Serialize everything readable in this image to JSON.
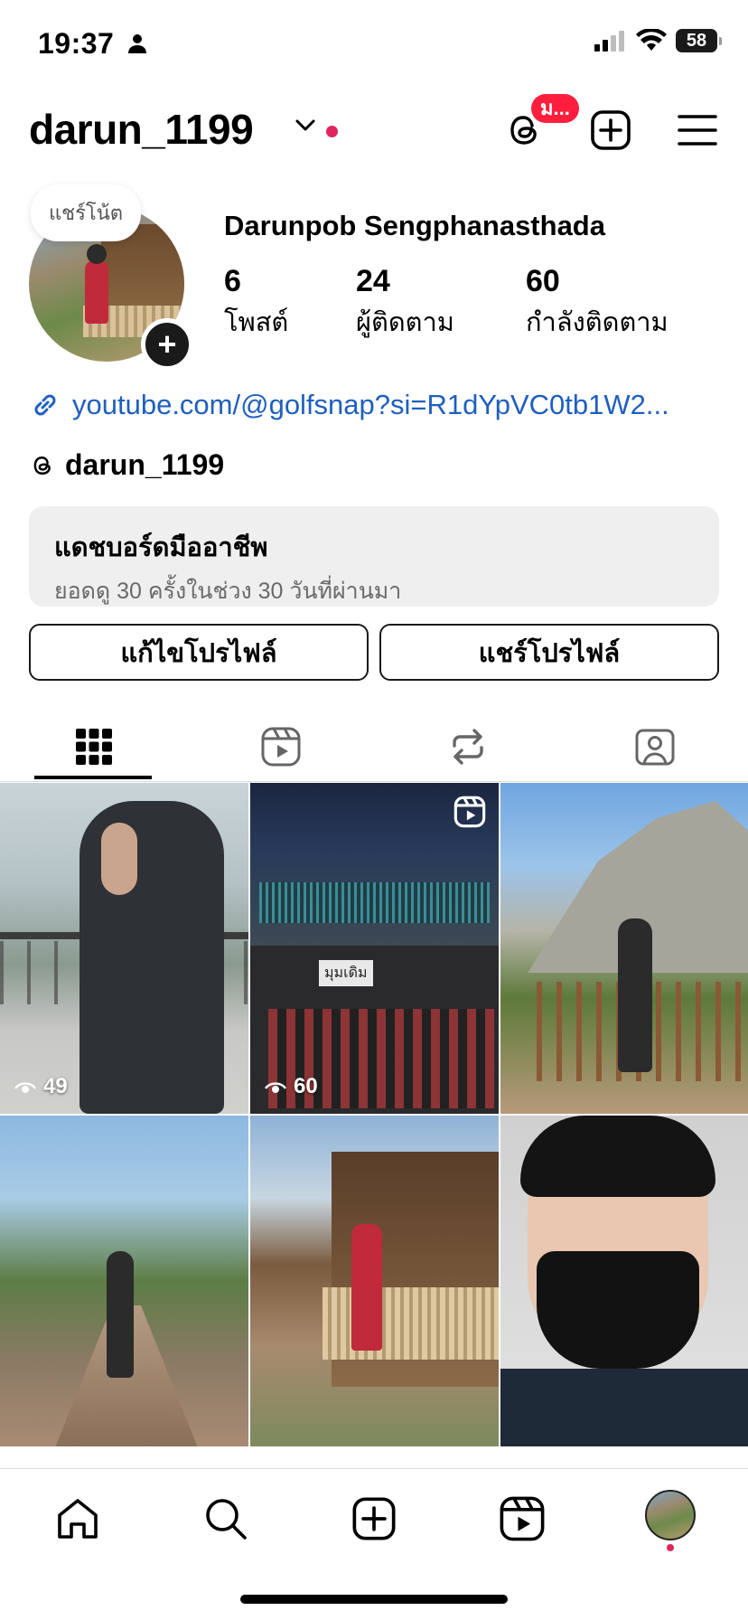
{
  "status_bar": {
    "time": "19:37",
    "battery": "58"
  },
  "header": {
    "username": "darun_1199",
    "threads_badge": "ม..."
  },
  "profile": {
    "note": "แชร์โน้ต",
    "full_name": "Darunpob Sengphanasthada",
    "stats": [
      {
        "value": "6",
        "label": "โพสต์"
      },
      {
        "value": "24",
        "label": "ผู้ติดตาม"
      },
      {
        "value": "60",
        "label": "กำลังติดตาม"
      }
    ],
    "link": "youtube.com/@golfsnap?si=R1dYpVC0tb1W2...",
    "threads_handle": "darun_1199"
  },
  "dashboard": {
    "title": "แดชบอร์ดมืออาชีพ",
    "subtitle": "ยอดดู 30 ครั้งในช่วง 30 วันที่ผ่านมา"
  },
  "buttons": {
    "edit_profile": "แก้ไขโปรไฟล์",
    "share_profile": "แชร์โปรไฟล์"
  },
  "tabs": [
    {
      "icon": "grid-icon",
      "active": true
    },
    {
      "icon": "reels-icon",
      "active": false
    },
    {
      "icon": "reposts-icon",
      "active": false
    },
    {
      "icon": "tagged-icon",
      "active": false
    }
  ],
  "posts": [
    {
      "views": "49",
      "type": "reel"
    },
    {
      "views": "60",
      "type": "reel",
      "caption": "มุมเดิม"
    },
    {
      "type": "photo"
    },
    {
      "type": "photo"
    },
    {
      "type": "photo"
    },
    {
      "type": "photo"
    }
  ],
  "bottom_nav": [
    "home-icon",
    "search-icon",
    "create-icon",
    "reels-icon",
    "profile-avatar"
  ],
  "colors": {
    "link": "#1f5fbf",
    "badge": "#ff1f3d",
    "accent_dot": "#e0245e"
  }
}
